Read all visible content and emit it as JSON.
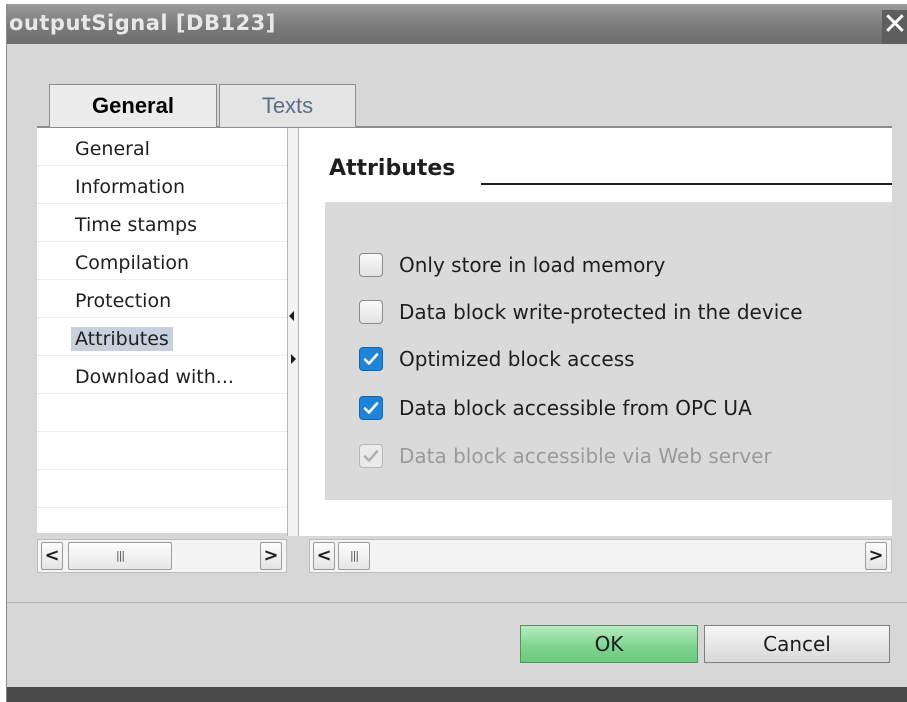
{
  "window": {
    "title": "outputSignal [DB123]"
  },
  "tabs": [
    {
      "label": "General",
      "selected": true
    },
    {
      "label": "Texts",
      "selected": false
    }
  ],
  "nav": {
    "items": [
      {
        "label": "General"
      },
      {
        "label": "Information"
      },
      {
        "label": "Time stamps"
      },
      {
        "label": "Compilation"
      },
      {
        "label": "Protection"
      },
      {
        "label": "Attributes",
        "selected": true
      },
      {
        "label": "Download with..."
      }
    ]
  },
  "section": {
    "title": "Attributes",
    "checkboxes": [
      {
        "label": "Only store in load memory",
        "checked": false,
        "enabled": true
      },
      {
        "label": "Data block write-protected in the device",
        "checked": false,
        "enabled": true
      },
      {
        "label": "Optimized block access",
        "checked": true,
        "enabled": true
      },
      {
        "label": "Data block accessible from OPC UA",
        "checked": true,
        "enabled": true
      },
      {
        "label": "Data block accessible via Web server",
        "checked": true,
        "enabled": false
      }
    ]
  },
  "scrollbars": {
    "left_arrow": "<",
    "right_arrow": ">",
    "thumb_grip": "|||"
  },
  "buttons": {
    "ok": "OK",
    "cancel": "Cancel"
  },
  "colors": {
    "checkbox_checked": "#1f84d9",
    "ok_button": "#7fd590",
    "selected_nav": "#c7d1de"
  },
  "icons": {
    "close": "close-icon",
    "check": "checkmark-icon"
  }
}
